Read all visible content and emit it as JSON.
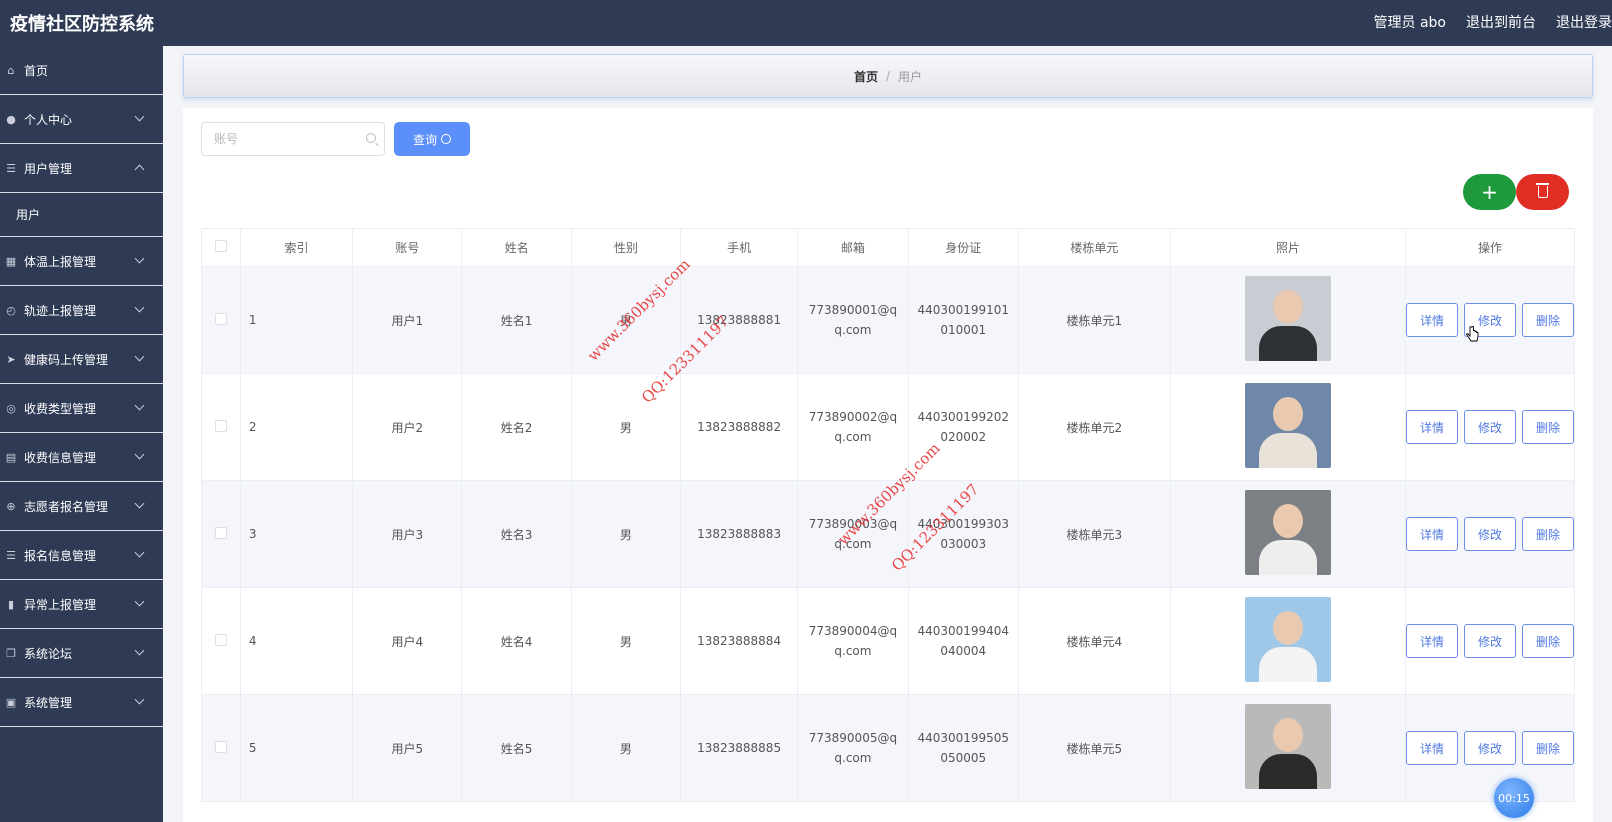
{
  "app": {
    "title": "疫情社区防控系统"
  },
  "header": {
    "user": "管理员 abo",
    "to_front": "退出到前台",
    "logout": "退出登录"
  },
  "sidebar": {
    "items": [
      {
        "label": "首页",
        "icon": "home-icon",
        "chevron": "none"
      },
      {
        "label": "个人中心",
        "icon": "user-icon",
        "chevron": "down"
      },
      {
        "label": "用户管理",
        "icon": "list-icon",
        "chevron": "up"
      },
      {
        "label": "体温上报管理",
        "icon": "grid-icon",
        "chevron": "down"
      },
      {
        "label": "轨迹上报管理",
        "icon": "compass-icon",
        "chevron": "down"
      },
      {
        "label": "健康码上传管理",
        "icon": "send-icon",
        "chevron": "down"
      },
      {
        "label": "收费类型管理",
        "icon": "circle-icon",
        "chevron": "down"
      },
      {
        "label": "收费信息管理",
        "icon": "document-icon",
        "chevron": "down"
      },
      {
        "label": "志愿者报名管理",
        "icon": "target-icon",
        "chevron": "down"
      },
      {
        "label": "报名信息管理",
        "icon": "list-icon",
        "chevron": "down"
      },
      {
        "label": "异常上报管理",
        "icon": "bar-chart-icon",
        "chevron": "down"
      },
      {
        "label": "系统论坛",
        "icon": "copy-icon",
        "chevron": "down"
      },
      {
        "label": "系统管理",
        "icon": "clipboard-icon",
        "chevron": "down"
      }
    ],
    "sub_item": "用户"
  },
  "breadcrumb": {
    "home": "首页",
    "separator": "/",
    "current": "用户"
  },
  "search": {
    "placeholder": "账号",
    "query_label": "查询"
  },
  "actions": {
    "add_symbol": "+"
  },
  "table": {
    "columns": [
      "索引",
      "账号",
      "姓名",
      "性别",
      "手机",
      "邮箱",
      "身份证",
      "楼栋单元",
      "照片",
      "操作"
    ],
    "rows": [
      {
        "index": "1",
        "account": "用户1",
        "name": "姓名1",
        "gender": "男",
        "phone": "13823888881",
        "email": "773890001@qq.com",
        "id_card": "440300199101010001",
        "unit": "楼栋单元1",
        "photo_bg": "#c9ccd2",
        "photo_cloth": "#2e3136"
      },
      {
        "index": "2",
        "account": "用户2",
        "name": "姓名2",
        "gender": "男",
        "phone": "13823888882",
        "email": "773890002@qq.com",
        "id_card": "440300199202020002",
        "unit": "楼栋单元2",
        "photo_bg": "#6f87a8",
        "photo_cloth": "#e8e2d8"
      },
      {
        "index": "3",
        "account": "用户3",
        "name": "姓名3",
        "gender": "男",
        "phone": "13823888883",
        "email": "773890003@qq.com",
        "id_card": "440300199303030003",
        "unit": "楼栋单元3",
        "photo_bg": "#7c7f83",
        "photo_cloth": "#eeeeee"
      },
      {
        "index": "4",
        "account": "用户4",
        "name": "姓名4",
        "gender": "男",
        "phone": "13823888884",
        "email": "773890004@qq.com",
        "id_card": "440300199404040004",
        "unit": "楼栋单元4",
        "photo_bg": "#9ec7e8",
        "photo_cloth": "#f3f3f3"
      },
      {
        "index": "5",
        "account": "用户5",
        "name": "姓名5",
        "gender": "男",
        "phone": "13823888885",
        "email": "773890005@qq.com",
        "id_card": "440300199505050005",
        "unit": "楼栋单元5",
        "photo_bg": "#b9b9b9",
        "photo_cloth": "#2b2b2b"
      }
    ],
    "op_labels": {
      "detail": "详情",
      "edit": "修改",
      "delete": "删除"
    }
  },
  "watermarks": {
    "site": "www.360bysj.com",
    "qq": "QQ:123311197"
  },
  "timer": "00:15"
}
